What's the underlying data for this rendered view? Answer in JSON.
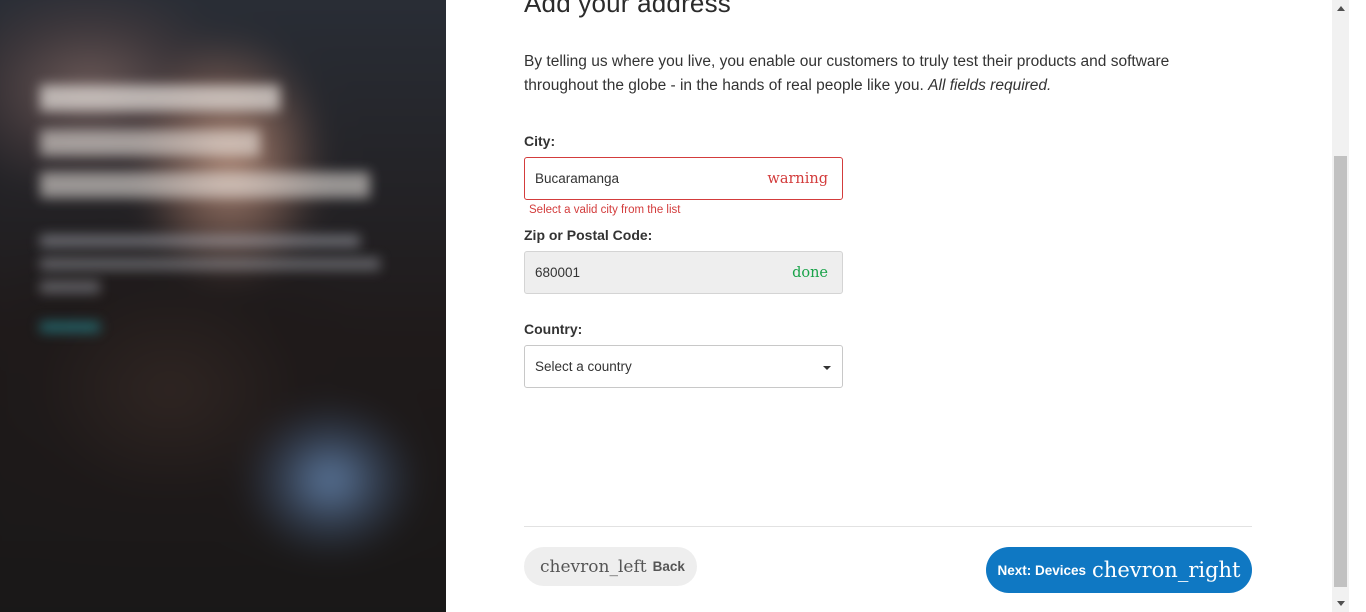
{
  "page": {
    "title": "Add your address",
    "intro_text": "By telling us where you live, you enable our customers to truly test their products and software throughout the globe - in the hands of real people like you.",
    "intro_required": "All fields required."
  },
  "form": {
    "city": {
      "label": "City:",
      "value": "Bucaramanga",
      "status_icon": "warning",
      "error": "Select a valid city from the list"
    },
    "zip": {
      "label": "Zip or Postal Code:",
      "value": "680001",
      "status_icon": "done"
    },
    "country": {
      "label": "Country:",
      "selected": "Select a country"
    }
  },
  "nav": {
    "back_icon": "chevron_left",
    "back_label": "Back",
    "next_label": "Next: Devices",
    "next_icon": "chevron_right"
  },
  "colors": {
    "primary": "#0f78c3",
    "error": "#d33c3c",
    "success": "#1aa34a"
  }
}
